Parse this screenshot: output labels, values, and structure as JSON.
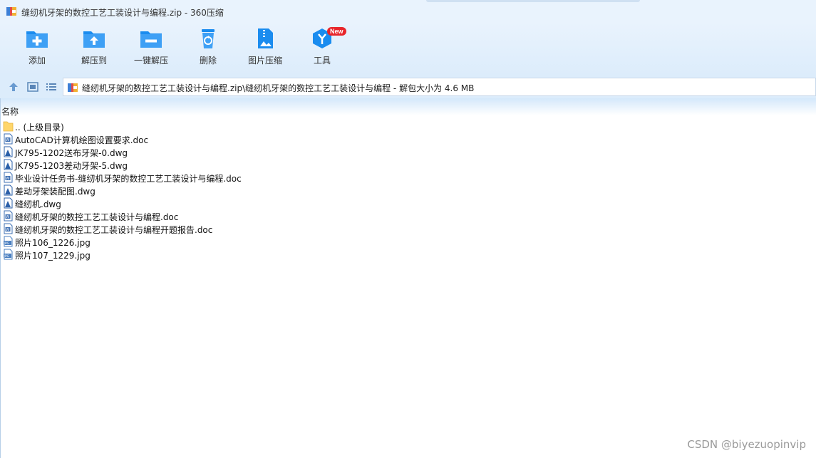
{
  "window": {
    "title": "缝纫机牙架的数控工艺工装设计与编程.zip - 360压缩",
    "icon": "zip-archive-icon"
  },
  "toolbar": {
    "items": [
      {
        "label": "添加",
        "icon": "add-folder-icon"
      },
      {
        "label": "解压到",
        "icon": "extract-to-folder-icon"
      },
      {
        "label": "一键解压",
        "icon": "one-click-extract-icon"
      },
      {
        "label": "删除",
        "icon": "recycle-bin-icon"
      },
      {
        "label": "图片压缩",
        "icon": "image-compress-icon"
      },
      {
        "label": "工具",
        "icon": "tools-icon",
        "badge": "New"
      }
    ]
  },
  "navbar": {
    "path": "缝纫机牙架的数控工艺工装设计与编程.zip\\缝纫机牙架的数控工艺工装设计与编程 - 解包大小为 4.6 MB"
  },
  "list": {
    "column_header": "名称",
    "items": [
      {
        "name": ".. (上级目录)",
        "type": "folder"
      },
      {
        "name": "AutoCAD计算机绘图设置要求.doc",
        "type": "doc"
      },
      {
        "name": "JK795-1202送布牙架-0.dwg",
        "type": "dwg"
      },
      {
        "name": "JK795-1203差动牙架-5.dwg",
        "type": "dwg"
      },
      {
        "name": "毕业设计任务书-缝纫机牙架的数控工艺工装设计与编程.doc",
        "type": "doc"
      },
      {
        "name": "差动牙架装配图.dwg",
        "type": "dwg"
      },
      {
        "name": "缝纫机.dwg",
        "type": "dwg"
      },
      {
        "name": "缝纫机牙架的数控工艺工装设计与编程.doc",
        "type": "doc"
      },
      {
        "name": "缝纫机牙架的数控工艺工装设计与编程开题报告.doc",
        "type": "doc"
      },
      {
        "name": "照片106_1226.jpg",
        "type": "jpg"
      },
      {
        "name": "照片107_1229.jpg",
        "type": "jpg"
      }
    ]
  },
  "watermark": "CSDN @biyezuopinvip",
  "colors": {
    "accent": "#1a8cef",
    "toolbar_bg": "#dcecfb",
    "badge": "#e8262b"
  }
}
